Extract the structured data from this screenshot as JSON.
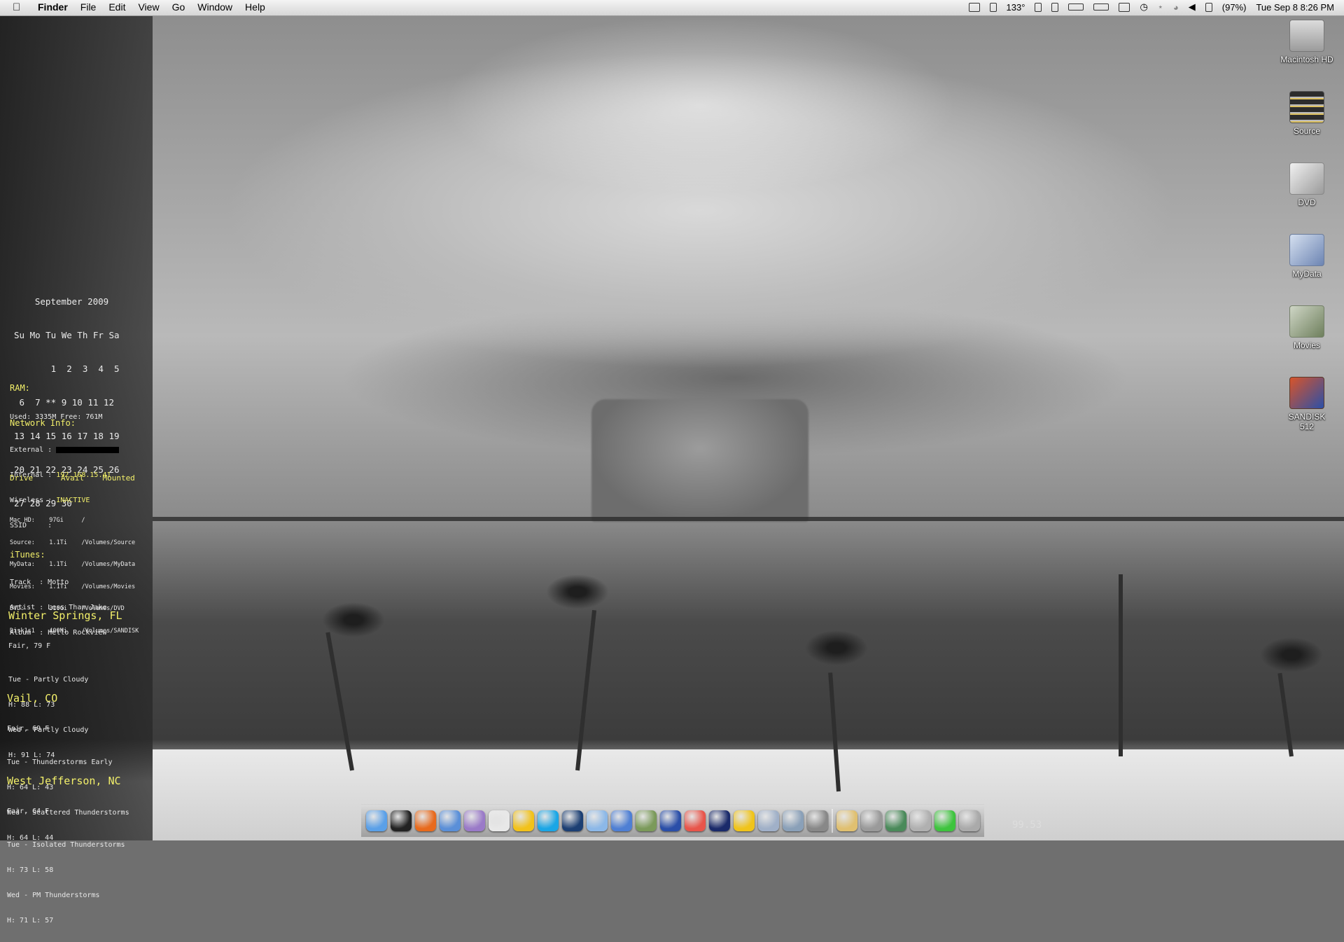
{
  "menubar": {
    "apple_icon": "apple-icon",
    "app_name": "Finder",
    "menus": [
      "File",
      "Edit",
      "View",
      "Go",
      "Window",
      "Help"
    ],
    "temperature": "133°",
    "battery": "(97%)",
    "clock": "Tue Sep 8  8:26 PM"
  },
  "calendar": {
    "title": "September 2009",
    "header": "Su Mo Tu We Th Fr Sa",
    "rows": [
      "       1  2  3  4  5",
      " 6  7 ** 9 10 11 12",
      "13 14 15 16 17 18 19",
      "20 21 22 23 24 25 26",
      "27 28 29 30"
    ]
  },
  "ram": {
    "heading": "RAM:",
    "line": "Used: 3335M Free: 761M"
  },
  "network": {
    "heading": "Network Info:",
    "external_label": "External :",
    "internal_label": "Internal :",
    "internal_value": "192.168.15.41",
    "wireless_label": "Wireless :",
    "wireless_value": "INACTIVE",
    "ssid_label": "SSID     :"
  },
  "drives": {
    "header": "Drive      Avail    Mounted",
    "rows": [
      "Mac HD:    97Gi     /",
      "Source:    1.1Ti    /Volumes/Source",
      "MyData:    1.1Ti    /Volumes/MyData",
      "Movies:    1.1Ti    /Volumes/Movies",
      "DVD:       310Gi    /Volumes/DVD",
      "Disk1s1    400Mi    /Volumes/SANDISK"
    ]
  },
  "itunes": {
    "heading": "iTunes:",
    "track": "Track  : Motto",
    "artist": "Artist : Less Than Jake",
    "album": "Album  : Hello Rockview"
  },
  "weather": [
    {
      "city": "Winter Springs, FL",
      "current": "Fair, 79 F",
      "lines": [
        "Tue - Partly Cloudy",
        "H: 88 L: 73",
        "Wed - Partly Cloudy",
        "H: 91 L: 74"
      ]
    },
    {
      "city": "Vail, CO",
      "current": "Fair, 69 F",
      "lines": [
        "Tue - Thunderstorms Early",
        "H: 64 L: 43",
        "Wed - Scattered Thunderstorms",
        "H: 64 L: 44"
      ]
    },
    {
      "city": "West Jefferson, NC",
      "current": "Fair, 64 F",
      "lines": [
        "Tue - Isolated Thunderstorms",
        "H: 73 L: 58",
        "Wed - PM Thunderstorms",
        "H: 71 L: 57"
      ]
    }
  ],
  "desktop_icons": [
    "Macintosh HD",
    "Source",
    "DVD",
    "MyData",
    "Movies",
    "SANDISK 512"
  ],
  "dock_items": [
    {
      "name": "finder",
      "color": "#5aa0e8"
    },
    {
      "name": "terminal",
      "color": "#222222"
    },
    {
      "name": "firefox",
      "color": "#e86a1c"
    },
    {
      "name": "safari",
      "color": "#5a8fd8"
    },
    {
      "name": "adium",
      "color": "#9a7ac8"
    },
    {
      "name": "textedit",
      "color": "#e8e8e8"
    },
    {
      "name": "messenger",
      "color": "#f2c21a"
    },
    {
      "name": "skype",
      "color": "#1aa6e6"
    },
    {
      "name": "photoshop",
      "color": "#1c3f73"
    },
    {
      "name": "itunes-alt",
      "color": "#8cb8e8"
    },
    {
      "name": "itunes",
      "color": "#4e7fd4"
    },
    {
      "name": "preview",
      "color": "#7b9a5a"
    },
    {
      "name": "network",
      "color": "#2a4ea8"
    },
    {
      "name": "mail",
      "color": "#e8554a"
    },
    {
      "name": "full-tilt",
      "color": "#1a2a6a"
    },
    {
      "name": "fire",
      "color": "#f0c41a"
    },
    {
      "name": "utilities",
      "color": "#a0b0c8"
    },
    {
      "name": "dvd-player",
      "color": "#8aa0b8"
    },
    {
      "name": "system-prefs",
      "color": "#888888"
    },
    {
      "name": "folder",
      "color": "#e0c070"
    },
    {
      "name": "downloads-stack",
      "color": "#9a9a9a"
    },
    {
      "name": "globe",
      "color": "#4a8a5a"
    },
    {
      "name": "tool",
      "color": "#b0b0b0"
    },
    {
      "name": "downloads",
      "color": "#3ec43e"
    },
    {
      "name": "trash",
      "color": "#aaaaaa"
    }
  ],
  "fps_readout": "99.53"
}
